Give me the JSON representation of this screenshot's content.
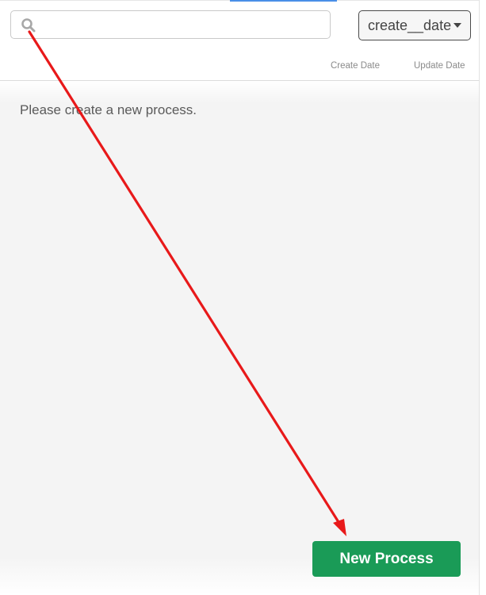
{
  "search": {
    "value": "",
    "placeholder": ""
  },
  "sort": {
    "selected": "create__date"
  },
  "columns": {
    "create_date": "Create Date",
    "update_date": "Update Date"
  },
  "empty_state": {
    "message": "Please create a new process."
  },
  "actions": {
    "new_process_label": "New Process"
  },
  "colors": {
    "primary_button": "#1a9b57",
    "annotation_arrow": "#e8191a",
    "tab_accent": "#4a8fe7"
  },
  "icons": {
    "search": "search-icon",
    "sort_dropdown": "caret-down-icon"
  }
}
